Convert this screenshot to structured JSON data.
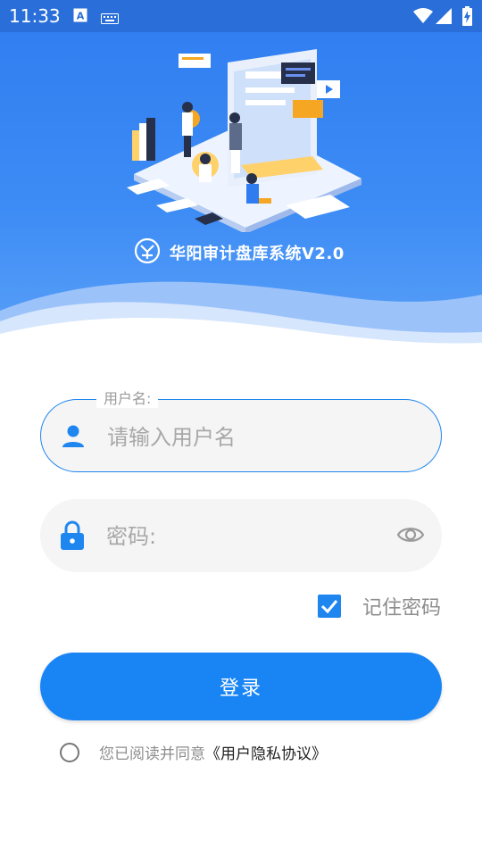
{
  "status_bar": {
    "time": "11:33",
    "icons": [
      "a-keyboard-icon",
      "keyboard-icon",
      "wifi-icon",
      "signal-icon",
      "battery-charging-icon"
    ]
  },
  "header": {
    "app_title": "华阳审计盘库系统V2.0",
    "logo_icon": "company-logo-icon",
    "colors": {
      "primary": "#2f7cf0",
      "accent": "#1985f5"
    }
  },
  "form": {
    "username": {
      "label": "用户名:",
      "placeholder": "请输入用户名",
      "value": "",
      "icon": "user-icon"
    },
    "password": {
      "placeholder": "密码:",
      "value": "",
      "icon": "lock-icon",
      "toggle_icon": "eye-icon"
    },
    "remember": {
      "label": "记住密码",
      "checked": true
    },
    "login_button": "登录",
    "agreement": {
      "prefix": "您已阅读并同意",
      "link": "《用户隐私协议》",
      "checked": false
    }
  }
}
